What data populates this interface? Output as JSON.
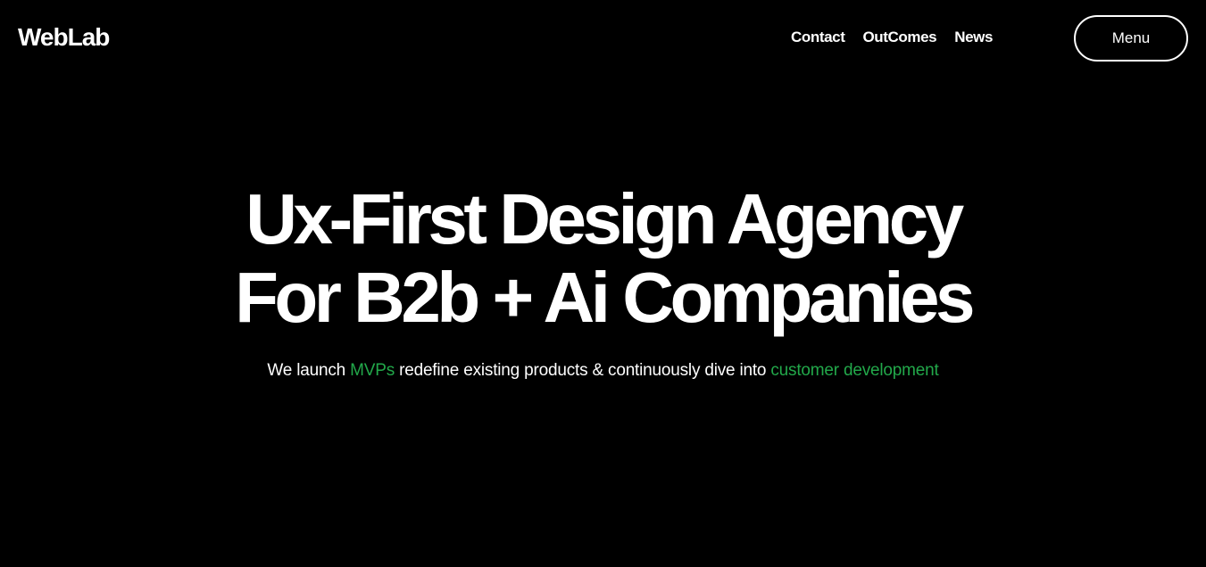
{
  "header": {
    "logo": "WebLab",
    "nav": [
      "Contact",
      "OutComes",
      "News"
    ],
    "menu_label": "Menu"
  },
  "hero": {
    "title_line1": "Ux-First Design Agency",
    "title_line2": "For B2b + Ai Companies",
    "subtitle": {
      "part1": "We launch ",
      "accent1": "MVPs",
      "part2": " redefine existing products & continuously dive into ",
      "accent2": "customer development"
    }
  },
  "colors": {
    "background": "#000000",
    "text": "#ffffff",
    "accent": "#22a84a"
  }
}
